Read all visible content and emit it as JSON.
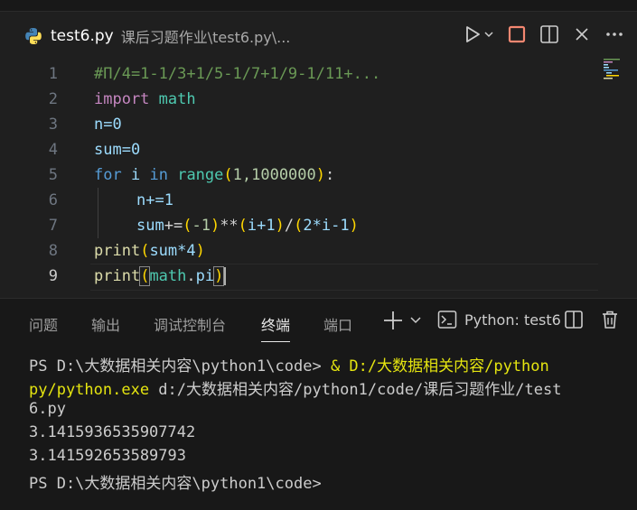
{
  "tab": {
    "filename": "test6.py",
    "path": "课后习题作业\\test6.py\\..."
  },
  "editor": {
    "line_numbers": [
      "1",
      "2",
      "3",
      "4",
      "5",
      "6",
      "7",
      "8",
      "9"
    ],
    "active_line": "9",
    "lines": {
      "l1": "#Π/4=1-1/3+1/5-1/7+1/9-1/11+...",
      "l2_kw": "import",
      "l2_mod": "math",
      "l3": "n=0",
      "l4": "sum=0",
      "l5_for": "for",
      "l5_i": "i",
      "l5_in": "in",
      "l5_range": "range",
      "l5_args": "1,1000000",
      "l6": "n+=1",
      "l7_sum": "sum",
      "l7_op": "+=",
      "l7_neg": "-1",
      "l7_pow": "**",
      "l7_i1": "i+1",
      "l7_div": "/",
      "l7_expr": "2*i-1",
      "l8_print": "print",
      "l8_arg": "sum*4",
      "l9_print": "print",
      "l9_mod": "math",
      "l9_attr": "pi"
    }
  },
  "panel": {
    "tabs": [
      "问题",
      "输出",
      "调试控制台",
      "终端",
      "端口"
    ],
    "active_tab": "终端",
    "terminal_name": "Python: test6"
  },
  "terminal": {
    "lines": [
      "PS D:\\大数据相关内容\\python1\\code> ",
      "& D:/大数据相关内容/python",
      "py/python.exe",
      " d:/大数据相关内容/python1/code/课后习题作业/test",
      "6.py",
      "3.1415936535907742",
      "3.141592653589793",
      "PS D:\\大数据相关内容\\python1\\code>"
    ]
  },
  "colors": {
    "keyword": "#569cd6",
    "import": "#c586c0",
    "function": "#dcdcaa",
    "variable": "#9cdcfe",
    "number": "#b5cea8",
    "comment": "#6a9955",
    "paren_level1": "#ffd700",
    "paren_level2": "#da70d6",
    "terminal_path": "#e5e510"
  }
}
